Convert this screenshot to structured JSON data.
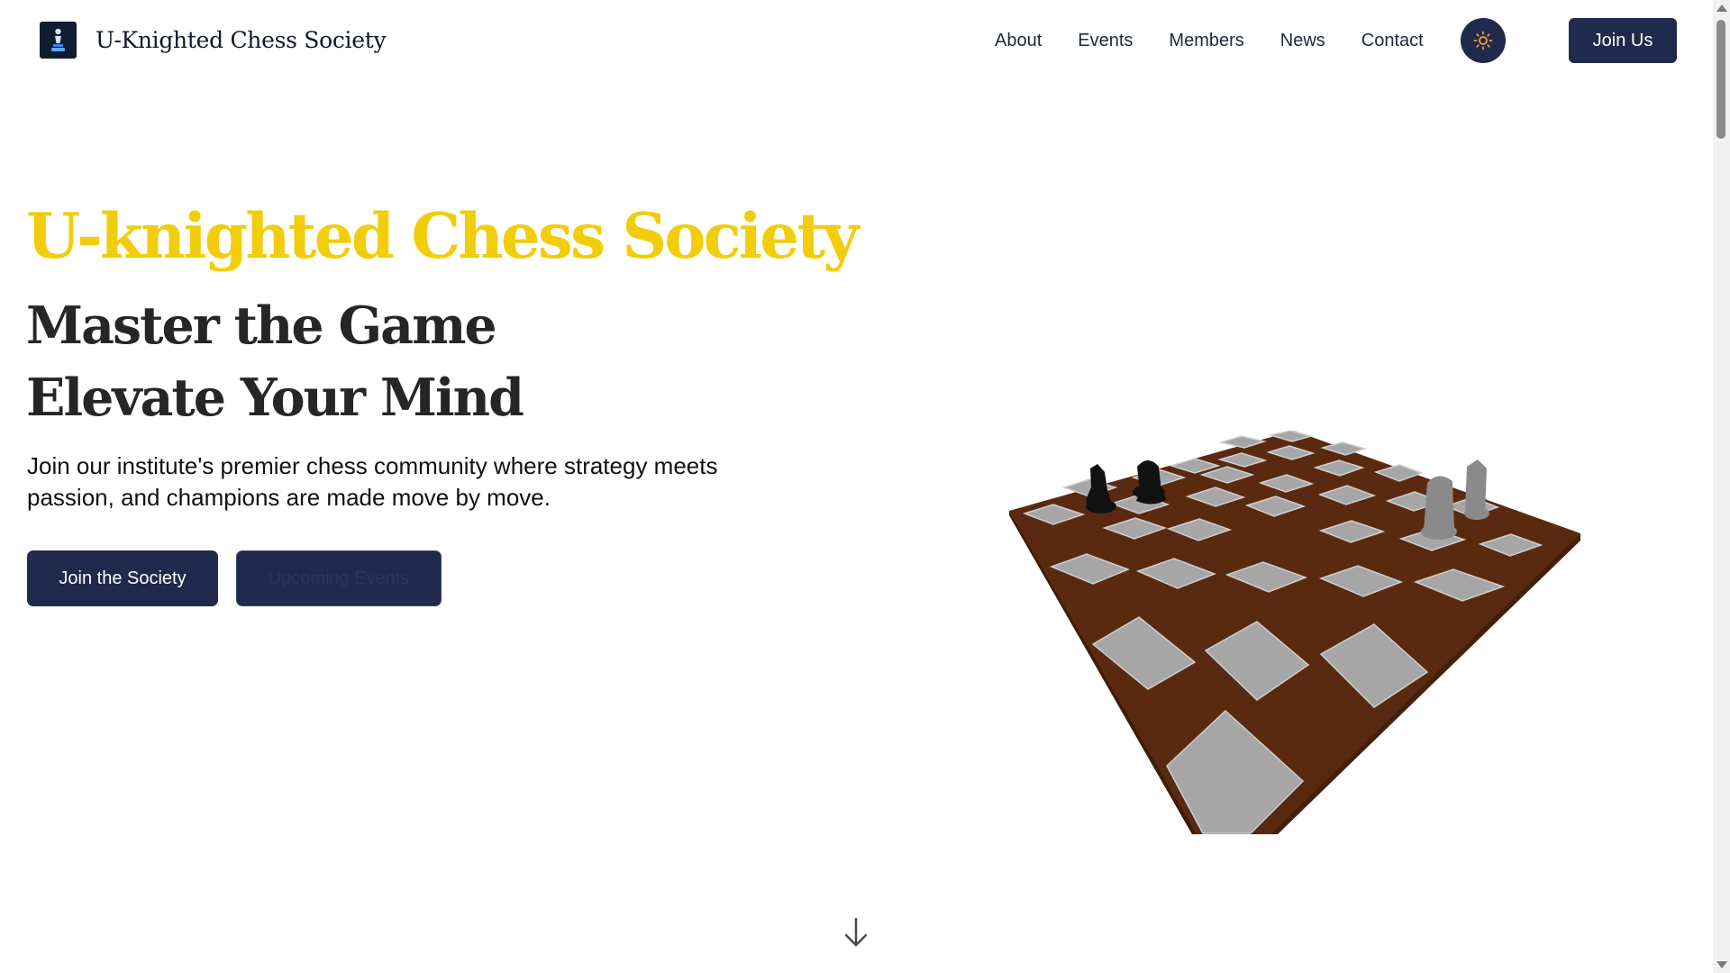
{
  "brand": {
    "name": "U-Knighted Chess Society",
    "logo_icon": "chess-pawn-icon"
  },
  "nav": {
    "items": [
      {
        "label": "About"
      },
      {
        "label": "Events"
      },
      {
        "label": "Members"
      },
      {
        "label": "News"
      },
      {
        "label": "Contact"
      }
    ],
    "theme_toggle_icon": "sun-icon",
    "cta_label": "Join Us"
  },
  "hero": {
    "title": "U-knighted Chess Society",
    "line1": "Master the Game",
    "line2": "Elevate Your Mind",
    "description": "Join our institute's premier chess community where strategy meets passion, and champions are made move by move.",
    "primary_button": "Join the Society",
    "secondary_button": "Upcoming Events"
  },
  "scroll_indicator_icon": "arrow-down-icon",
  "colors": {
    "accent_yellow": "#f2cd0c",
    "navy": "#1f2a4d",
    "board_brown": "#5a2a10",
    "tile_light": "#a6a6a6"
  }
}
